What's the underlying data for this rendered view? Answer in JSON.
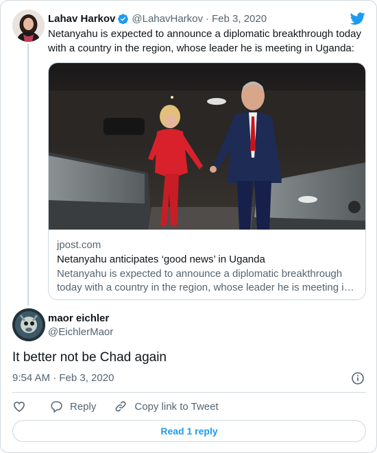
{
  "quoted_tweet": {
    "author_name": "Lahav Harkov",
    "handle": "@LahavHarkov",
    "separator": "·",
    "date": "Feb 3, 2020",
    "text": "Netanyahu is expected to announce a diplomatic breakthrough today with a country in the region, whose leader he is meeting in Uganda:",
    "link_card": {
      "domain": "jpost.com",
      "title": "Netanyahu anticipates ‘good news’ in Uganda",
      "description_line1": "Netanyahu is expected to announce a diplomatic breakthrough",
      "description_line2": "today with a country in the region, whose leader he is meeting i…"
    }
  },
  "reply_tweet": {
    "author_name": "maor eichler",
    "handle": "@EichlerMaor",
    "text": "It better not be Chad again",
    "timestamp": "9:54 AM · Feb 3, 2020"
  },
  "actions": {
    "reply_label": "Reply",
    "copy_link_label": "Copy link to Tweet"
  },
  "read_replies_label": "Read 1 reply",
  "icons": {
    "verified": "verified-badge-icon",
    "brand": "twitter-bird-icon",
    "info": "info-icon",
    "like": "heart-icon",
    "reply": "speech-bubble-icon",
    "copy_link": "link-icon"
  },
  "colors": {
    "accent": "#1d9bf0",
    "text_primary": "#0f1419",
    "text_secondary": "#536471",
    "border": "#cfd9de"
  }
}
